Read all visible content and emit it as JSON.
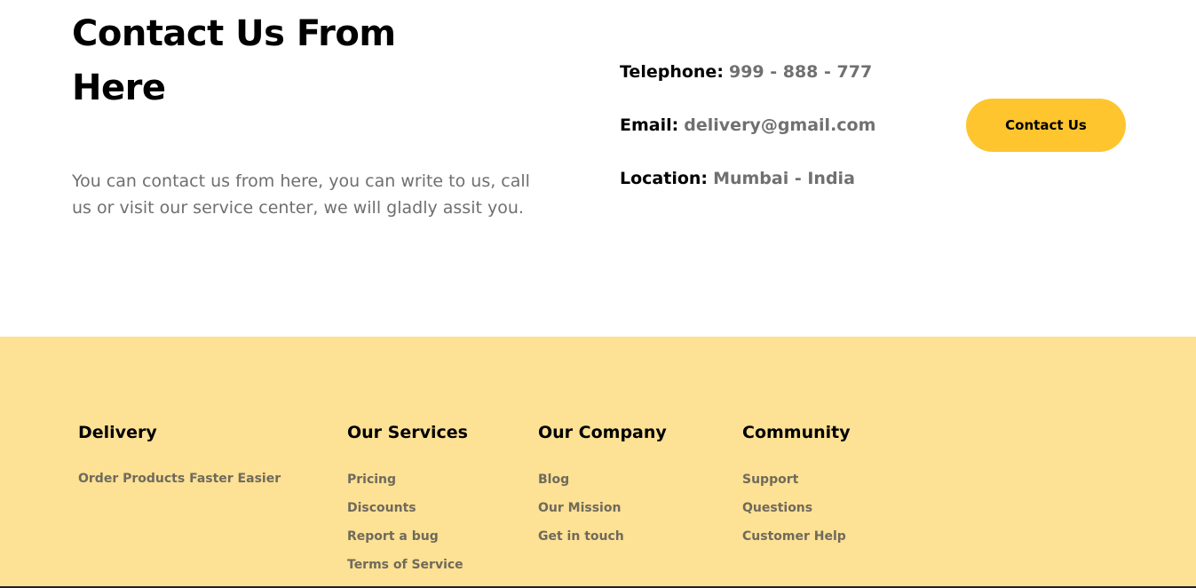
{
  "contact": {
    "title": "Contact Us From Here",
    "description": "You can contact us from here, you can write to us, call us or visit our service center, we will gladly assit you.",
    "telephone_label": "Telephone:",
    "telephone_value": "999 - 888 - 777",
    "email_label": "Email:",
    "email_value": "delivery@gmail.com",
    "location_label": "Location:",
    "location_value": "Mumbai - India",
    "button_label": "Contact Us"
  },
  "footer": {
    "delivery": {
      "heading": "Delivery",
      "tagline": "Order Products Faster Easier"
    },
    "services": {
      "heading": "Our Services",
      "links": [
        "Pricing",
        "Discounts",
        "Report a bug",
        "Terms of Service"
      ]
    },
    "company": {
      "heading": "Our Company",
      "links": [
        "Blog",
        "Our Mission",
        "Get in touch"
      ]
    },
    "community": {
      "heading": "Community",
      "links": [
        "Support",
        "Questions",
        "Customer Help"
      ]
    }
  },
  "colors": {
    "accent": "#fec52e",
    "footer_bg": "#fde194",
    "muted_text": "#707070"
  }
}
